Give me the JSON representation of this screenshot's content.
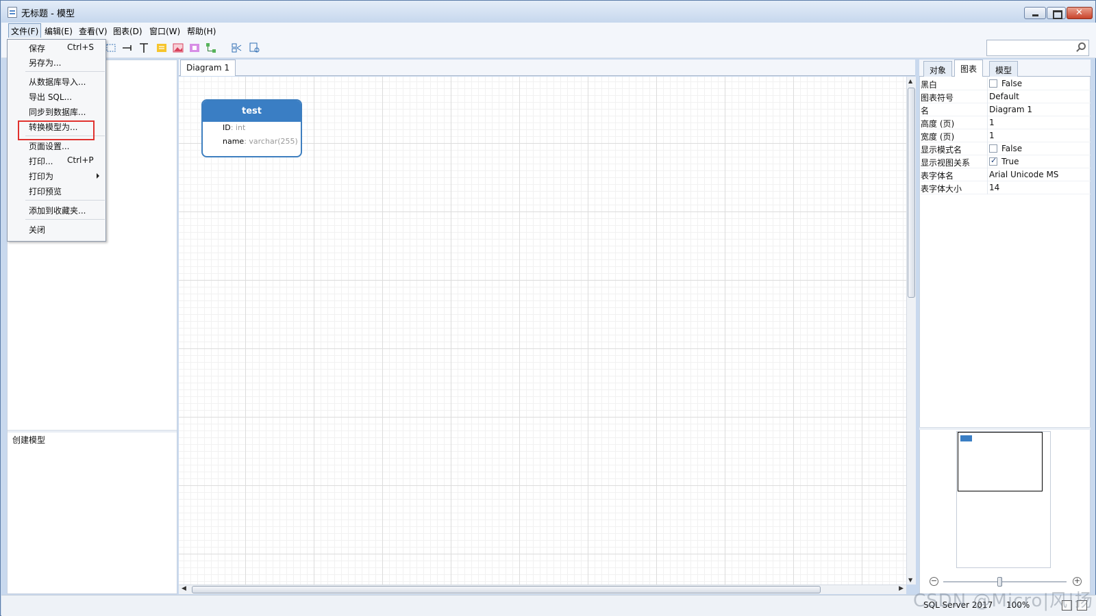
{
  "window": {
    "title": "无标题 - 模型"
  },
  "menubar": {
    "items": [
      "文件(F)",
      "编辑(E)",
      "查看(V)",
      "图表(D)",
      "窗口(W)",
      "帮助(H)"
    ]
  },
  "file_menu": {
    "items": [
      {
        "label": "保存",
        "shortcut": "Ctrl+S"
      },
      {
        "label": "另存为..."
      },
      {
        "label": "从数据库导入..."
      },
      {
        "label": "导出 SQL..."
      },
      {
        "label": "同步到数据库..."
      },
      {
        "label": "转换模型为..."
      },
      {
        "label": "页面设置..."
      },
      {
        "label": "打印...",
        "shortcut": "Ctrl+P"
      },
      {
        "label": "打印为"
      },
      {
        "label": "打印预览"
      },
      {
        "label": "添加到收藏夹..."
      },
      {
        "label": "关闭"
      }
    ]
  },
  "left_panel": {
    "hint": "创建模型"
  },
  "diagram": {
    "tab": "Diagram 1",
    "entity": {
      "name": "test",
      "fields": [
        {
          "name": "ID",
          "type": ": int"
        },
        {
          "name": "name",
          "type": ": varchar(255)"
        }
      ]
    }
  },
  "right_panel": {
    "tabs": [
      "对象",
      "图表",
      "模型"
    ],
    "properties": [
      {
        "key": "黑白",
        "value": "False"
      },
      {
        "key": "图表符号",
        "value": "Default"
      },
      {
        "key": "名",
        "value": "Diagram 1"
      },
      {
        "key": "高度 (页)",
        "value": "1"
      },
      {
        "key": "宽度 (页)",
        "value": "1"
      },
      {
        "key": "显示模式名",
        "value": "False"
      },
      {
        "key": "显示视图关系",
        "value": "True"
      },
      {
        "key": "表字体名",
        "value": "Arial Unicode MS"
      },
      {
        "key": "表字体大小",
        "value": "14"
      }
    ]
  },
  "statusbar": {
    "db": "SQL Server 2017",
    "zoom": "100%"
  },
  "watermark": "CSDN @Micro|风|扬",
  "colors": {
    "accent": "#3a7ec4",
    "highlight": "#e0312e"
  }
}
